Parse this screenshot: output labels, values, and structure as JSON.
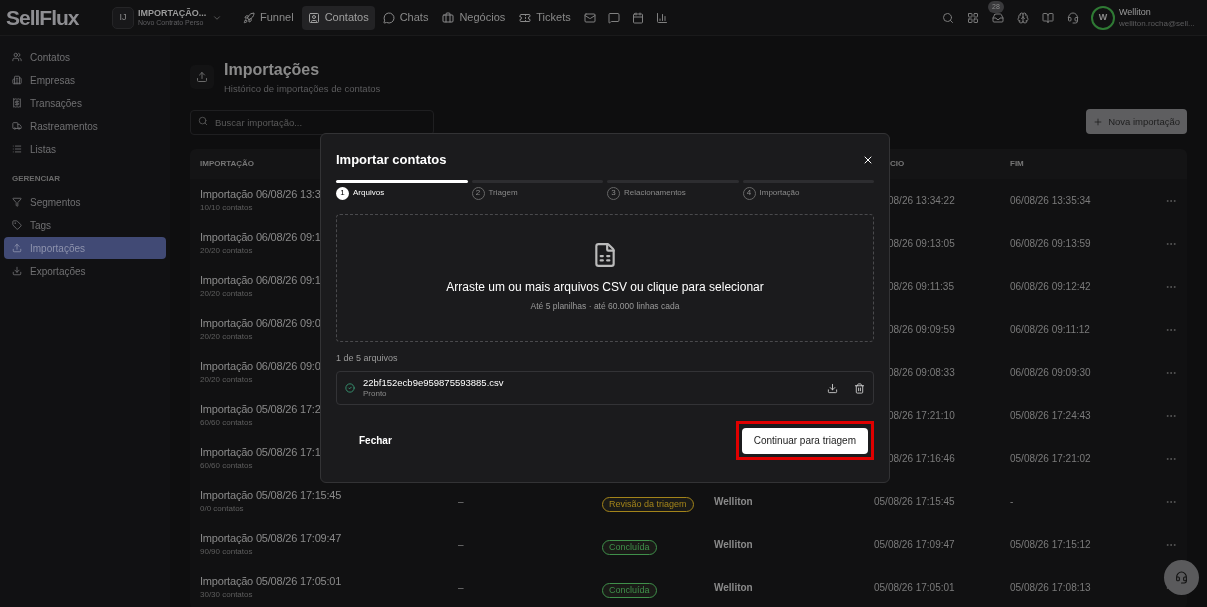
{
  "brand": {
    "logo": "SellFlux",
    "workspace_initials": "IJ",
    "workspace_name": "IMPORTAÇÃO...",
    "workspace_subtitle": "Novo Contrato Perso"
  },
  "nav": [
    {
      "label": "Funnel",
      "selected": false
    },
    {
      "label": "Contatos",
      "selected": true
    },
    {
      "label": "Chats",
      "selected": false
    },
    {
      "label": "Negócios",
      "selected": false
    },
    {
      "label": "Tickets",
      "selected": false
    },
    {
      "selected": false
    },
    {
      "selected": false
    },
    {
      "selected": false
    },
    {
      "selected": false
    }
  ],
  "inbox_badge": "28",
  "user": {
    "initial": "W",
    "name": "Welliton",
    "email": "welliton.rocha@sell..."
  },
  "sidebar": [
    {
      "items": [
        {
          "label": "Contatos",
          "selected": false
        },
        {
          "label": "Empresas",
          "selected": false
        },
        {
          "label": "Transações",
          "selected": false
        },
        {
          "label": "Rastreamentos",
          "selected": false
        },
        {
          "label": "Listas",
          "selected": false
        }
      ]
    },
    {
      "title": "GERENCIAR",
      "items": [
        {
          "label": "Segmentos",
          "selected": false
        },
        {
          "label": "Tags",
          "selected": false
        },
        {
          "label": "Importações",
          "selected": true
        },
        {
          "label": "Exportações",
          "selected": false
        }
      ]
    }
  ],
  "page": {
    "title": "Importações",
    "subtitle": "Histórico de importações de contatos",
    "search_placeholder": "Buscar importação...",
    "new_button": "Nova importação"
  },
  "table": {
    "columns": [
      {
        "label": "IMPORTAÇÃO"
      },
      {
        "label": "CIO"
      },
      {
        "label": "FIM"
      }
    ],
    "rows": [
      {
        "kind": "behind_dialog",
        "name": "Importação 06/08/26 13:3",
        "count": "10/10 contatos",
        "start": "08/26 13:34:22",
        "end": "06/08/26 13:35:34"
      },
      {
        "kind": "behind_dialog",
        "name": "Importação 06/08/26 09:1",
        "count": "20/20 contatos",
        "start": "08/26 09:13:05",
        "end": "06/08/26 09:13:59"
      },
      {
        "kind": "behind_dialog",
        "name": "Importação 06/08/26 09:1",
        "count": "20/20 contatos",
        "start": "08/26 09:11:35",
        "end": "06/08/26 09:12:42"
      },
      {
        "kind": "behind_dialog",
        "name": "Importação 06/08/26 09:0",
        "count": "20/20 contatos",
        "start": "08/26 09:09:59",
        "end": "06/08/26 09:11:12"
      },
      {
        "kind": "behind_dialog",
        "name": "Importação 06/08/26 09:0",
        "count": "20/20 contatos",
        "start": "08/26 09:08:33",
        "end": "06/08/26 09:09:30"
      },
      {
        "kind": "behind_dialog",
        "name": "Importação 05/08/26 17:2",
        "count": "60/60 contatos",
        "start": "08/26 17:21:10",
        "end": "05/08/26 17:24:43"
      },
      {
        "kind": "behind_dialog",
        "name": "Importação 05/08/26 17:1",
        "count": "60/60 contatos",
        "start": "08/26 17:16:46",
        "end": "05/08/26 17:21:02"
      },
      {
        "kind": "full",
        "name": "Importação 05/08/26 17:15:45",
        "count": "0/0 contatos",
        "source": "–",
        "status": "Revisão da triagem",
        "color": "#a3841a",
        "user": "Welliton",
        "start": "05/08/26 17:15:45",
        "end": "-"
      },
      {
        "kind": "full",
        "name": "Importação 05/08/26 17:09:47",
        "count": "90/90 contatos",
        "source": "–",
        "status": "Concluída",
        "color": "#3f8f4a",
        "user": "Welliton",
        "start": "05/08/26 17:09:47",
        "end": "05/08/26 17:15:12"
      },
      {
        "kind": "full",
        "name": "Importação 05/08/26 17:05:01",
        "count": "30/30 contatos",
        "source": "–",
        "status": "Concluída",
        "color": "#3f8f4a",
        "user": "Welliton",
        "start": "05/08/26 17:05:01",
        "end": "05/08/26 17:08:13"
      }
    ]
  },
  "dialog": {
    "title": "Importar contatos",
    "steps": [
      {
        "number": "1",
        "label": "Arquivos",
        "selected": true
      },
      {
        "number": "2",
        "label": "Triagem",
        "selected": false
      },
      {
        "number": "3",
        "label": "Relacionamentos",
        "selected": false
      },
      {
        "number": "4",
        "label": "Importação",
        "selected": false
      }
    ],
    "dropzone_title": "Arraste um ou mais arquivos CSV ou clique para selecionar",
    "dropzone_hint": "Até 5 planilhas · até 60.000 linhas cada",
    "file_count": "1 de 5 arquivos",
    "files": [
      {
        "name": "22bf152ecb9e959875593885.csv",
        "status": "Pronto"
      }
    ],
    "close_button": "Fechar",
    "continue_button": "Continuar para triagem",
    "continue_highlighted": true
  }
}
